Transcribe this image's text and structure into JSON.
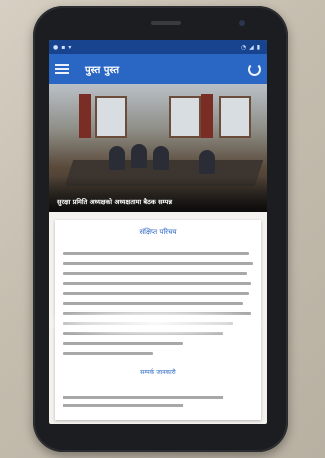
{
  "app": {
    "title": "पुस्त पुस्त"
  },
  "status_bar": {
    "left_icons": [
      "notification-icon",
      "notification-icon",
      "download-icon"
    ],
    "right_icons": [
      "wifi-icon",
      "signal-icon",
      "battery-icon"
    ],
    "time": ""
  },
  "hero": {
    "caption": "सुरक्षा प्रमिति अध्यक्षको अध्यक्षतामा बैठक सम्पन्न"
  },
  "card": {
    "title": "संक्षिप्त परिचय",
    "link_label": "सम्पर्क जानकारी"
  },
  "fab": {
    "symbol": "+"
  },
  "colors": {
    "status_bar": "#17438f",
    "app_bar": "#2a66c4",
    "fab": "#e5323b"
  }
}
